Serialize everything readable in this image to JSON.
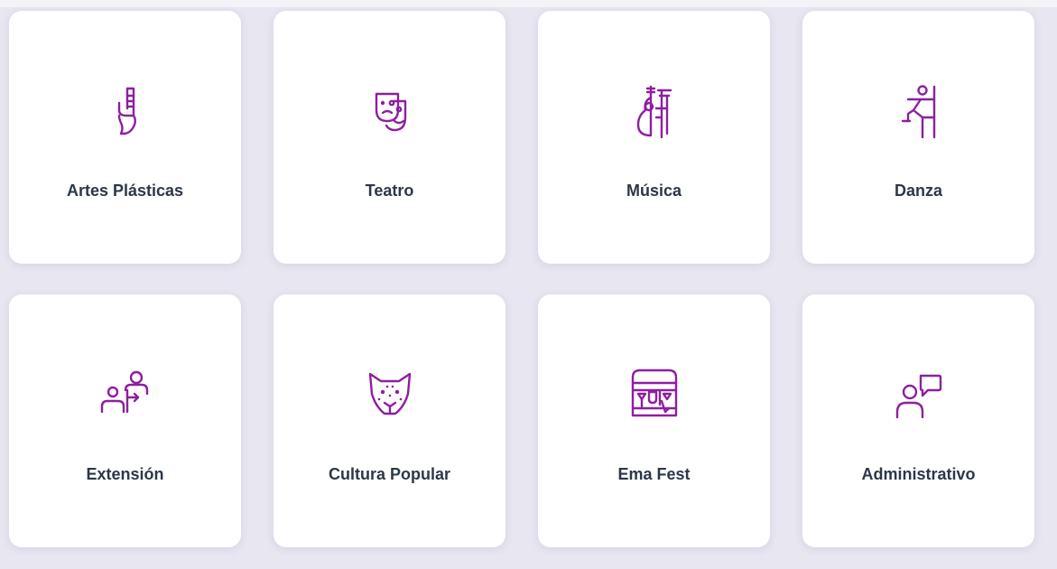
{
  "accent_color": "#8e1fa0",
  "cards": [
    {
      "label": "Artes Plásticas",
      "icon": "paintbrush-icon"
    },
    {
      "label": "Teatro",
      "icon": "theater-masks-icon"
    },
    {
      "label": "Música",
      "icon": "violin-icon"
    },
    {
      "label": "Danza",
      "icon": "dancer-icon"
    },
    {
      "label": "Extensión",
      "icon": "people-extension-icon"
    },
    {
      "label": "Cultura Popular",
      "icon": "jaguar-mask-icon"
    },
    {
      "label": "Ema Fest",
      "icon": "festival-stand-icon"
    },
    {
      "label": "Administrativo",
      "icon": "person-speech-icon"
    }
  ]
}
